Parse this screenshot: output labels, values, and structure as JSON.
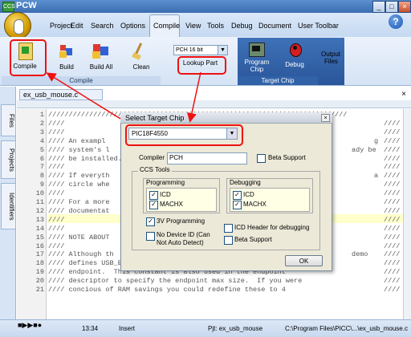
{
  "window": {
    "title": "PCW",
    "app_icon": "CCS"
  },
  "menu": {
    "items": [
      "Project",
      "Edit",
      "Search",
      "Options",
      "Compile",
      "View",
      "Tools",
      "Debug",
      "Document",
      "User Toolbar"
    ],
    "help_glyph": "?"
  },
  "ribbon": {
    "compile_group": {
      "label": "Compile",
      "buttons": [
        "Compile",
        "Build",
        "Build All",
        "Clean"
      ]
    },
    "compiler_select": "PCH 16 bit",
    "lookup_part": "Lookup Part",
    "target_chip_group": {
      "label": "Target Chip",
      "program_chip": [
        "Program",
        "Chip"
      ],
      "debug": "Debug"
    },
    "output_files": [
      "Output",
      "Files"
    ]
  },
  "sidebar": {
    "tabs": [
      "Files",
      "Projects",
      "Identifiers"
    ]
  },
  "editor": {
    "tab_label": "ex_usb_mouse.c",
    "lines": [
      {
        "n": "1",
        "t": "/////////////////////////////////////////////////////////////////////////"
      },
      {
        "n": "2",
        "t": "////"
      },
      {
        "n": "3",
        "t": "////"
      },
      {
        "n": "4",
        "t": "//// An exampl"
      },
      {
        "n": "5",
        "t": "//// system's l"
      },
      {
        "n": "6",
        "t": "//// be installed."
      },
      {
        "n": "7",
        "t": "////"
      },
      {
        "n": "8",
        "t": "//// If everyth"
      },
      {
        "n": "9",
        "t": "//// circle whe"
      },
      {
        "n": "10",
        "t": "////"
      },
      {
        "n": "11",
        "t": "//// For a more"
      },
      {
        "n": "12",
        "t": "//// documentat"
      },
      {
        "n": "13",
        "t": "////"
      },
      {
        "n": "14",
        "t": "////"
      },
      {
        "n": "15",
        "t": "//// NOTE ABOUT"
      },
      {
        "n": "16",
        "t": "////"
      },
      {
        "n": "17",
        "t": "//// Although th"
      },
      {
        "n": "18",
        "t": "//// defines USB_EP1_TX_SIZE  to  8 to allocate 8 bytes for this"
      },
      {
        "n": "19",
        "t": "//// endpoint.  This constant is also used in the endpoint"
      },
      {
        "n": "20",
        "t": "//// descriptor to specify the endpoint max size.  If you were"
      },
      {
        "n": "21",
        "t": "//// concious of RAM savings you could redefine these to 4"
      }
    ],
    "right_fragments": {
      "4": "g",
      "5": "ady be",
      "8": "a",
      "17": "demo"
    },
    "right_comment": "////"
  },
  "dialog": {
    "title": "Select Target Chip",
    "chip": "PIC18F4550",
    "compiler_label": "Compiler",
    "compiler_value": "PCH",
    "beta_support_label": "Beta Support",
    "ccs_tools_label": "CCS Tools",
    "programming": {
      "label": "Programming",
      "items": [
        "ICD",
        "MACHX"
      ]
    },
    "debugging": {
      "label": "Debugging",
      "items": [
        "ICD",
        "MACHX"
      ]
    },
    "three_v_programming": "3V Programming",
    "no_device_id": "No Device ID (Can Not Auto Detect)",
    "icd_header": "ICD Header for debugging",
    "beta_support2": "Beta Support",
    "ok": "OK"
  },
  "status": {
    "time": "13:34",
    "mode": "Insert",
    "project": "Pjt: ex_usb_mouse",
    "path": "C:\\Program Files\\PICC\\...\\ex_usb_mouse.c"
  },
  "accent_colors": {
    "highlight": "#ee1111",
    "ribbon": "#d4e3f5",
    "target_chip": "#2a559a"
  }
}
